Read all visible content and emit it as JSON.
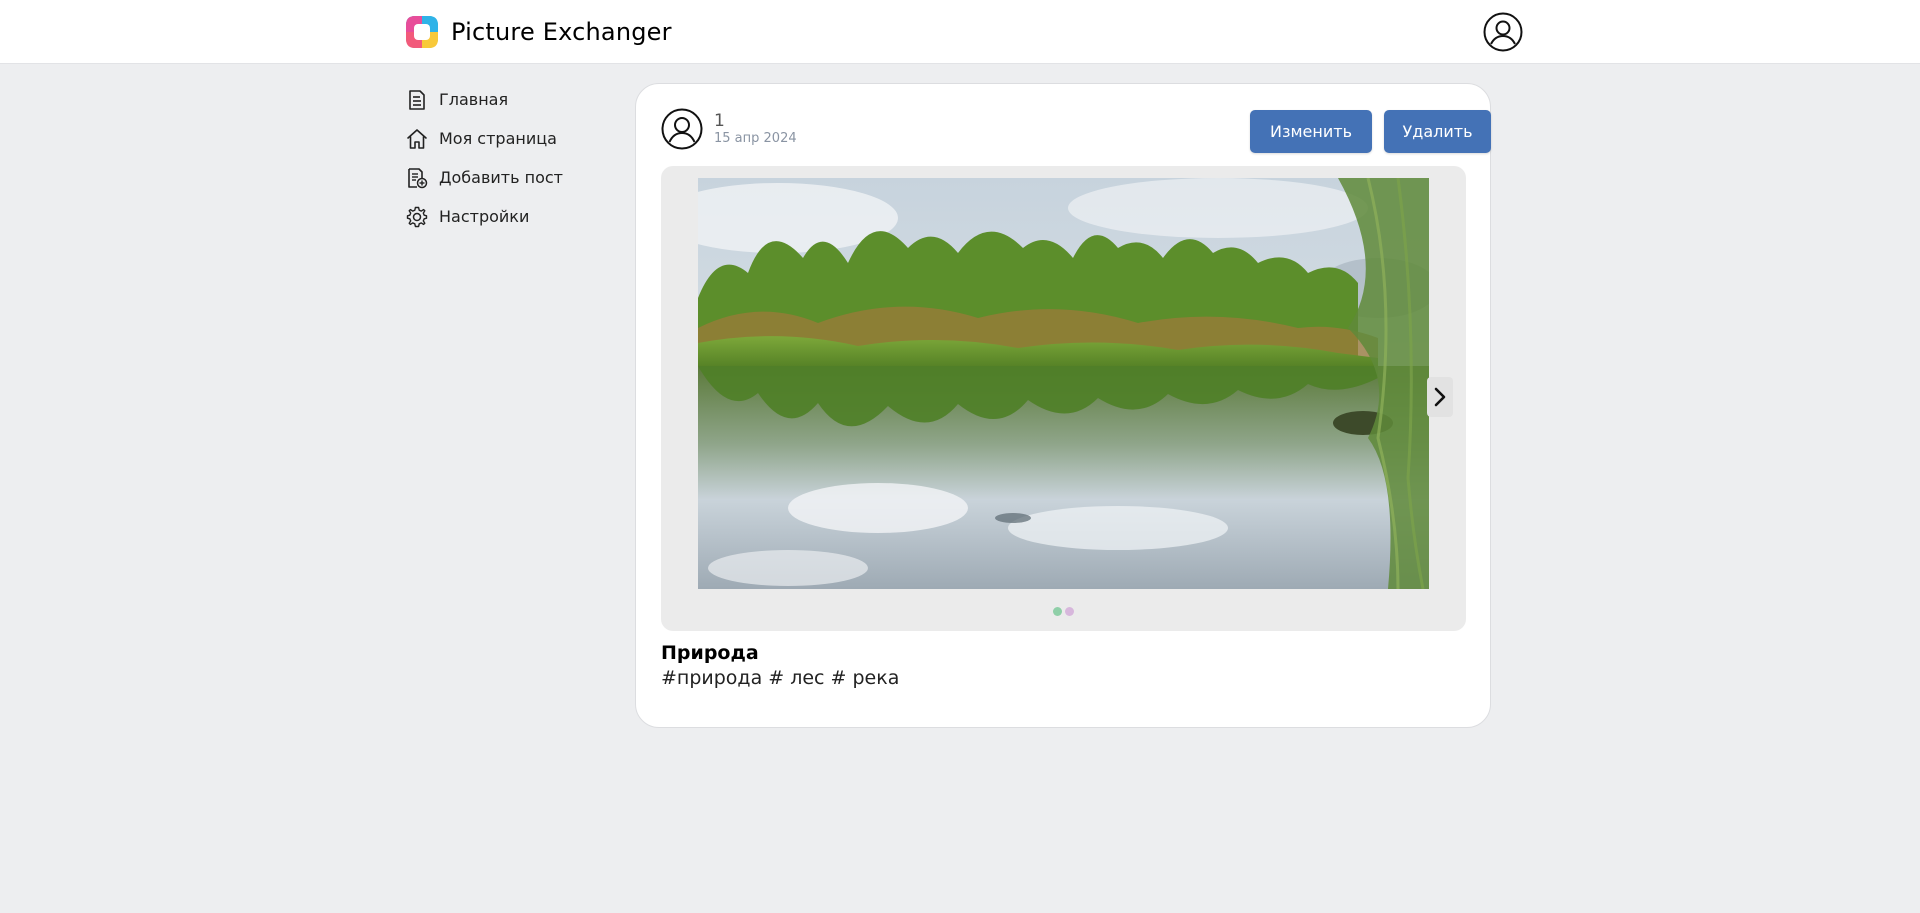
{
  "header": {
    "app_title": "Picture Exchanger",
    "logo_icon": "app-logo-icon",
    "profile_icon": "user-circle-icon"
  },
  "sidebar": {
    "items": [
      {
        "label": "Главная",
        "icon": "document-icon"
      },
      {
        "label": "Моя страница",
        "icon": "home-icon"
      },
      {
        "label": "Добавить пост",
        "icon": "add-post-icon"
      },
      {
        "label": "Настройки",
        "icon": "gear-icon"
      }
    ]
  },
  "post": {
    "author": "1",
    "date": "15 апр 2024",
    "edit_label": "Изменить",
    "delete_label": "Удалить",
    "title": "Природа",
    "tags": "#природа # лес # река",
    "carousel": {
      "image_description_icon": "landscape-photo",
      "slide_count": 2,
      "active_slide": 1,
      "dot_colors": [
        "#8fcfa8",
        "#d7b7dc"
      ]
    }
  },
  "colors": {
    "background": "#edeef0",
    "accent": "#4472b6",
    "card": "#ffffff"
  }
}
